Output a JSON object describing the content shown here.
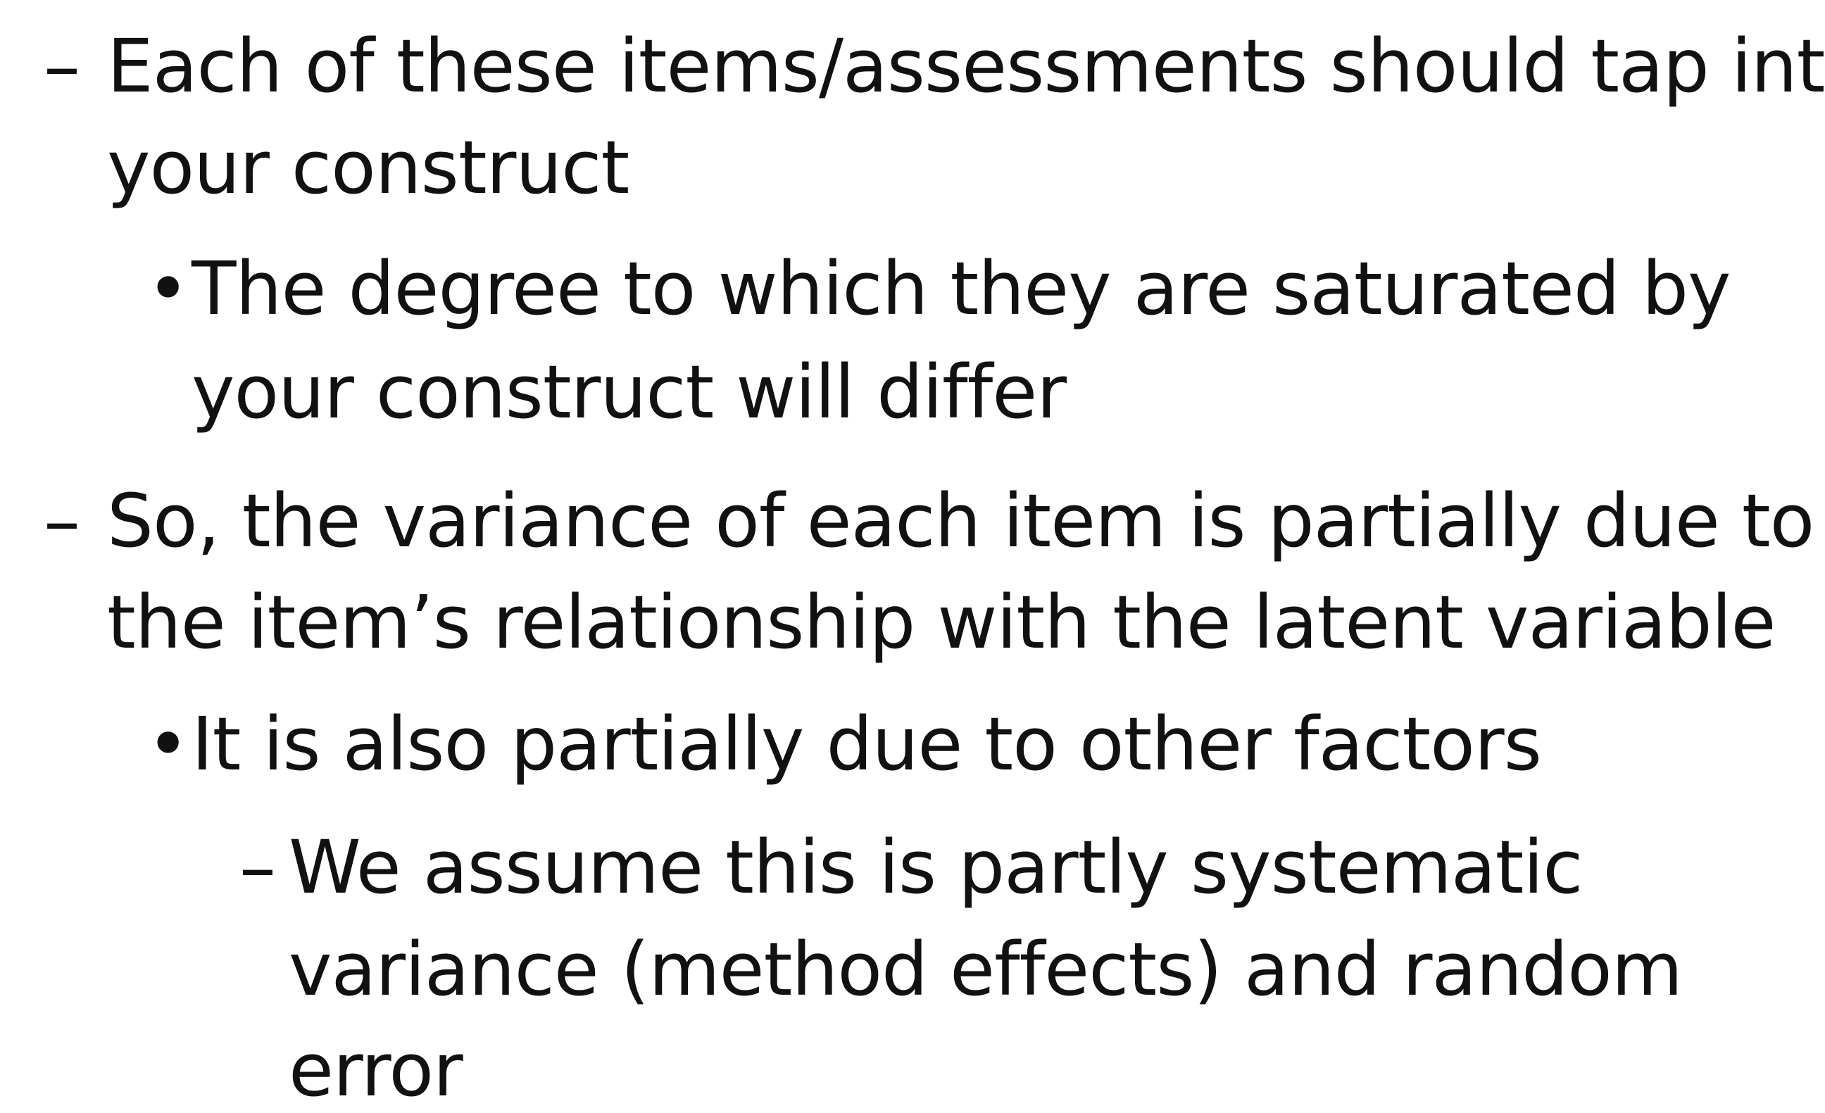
{
  "markers": {
    "dash": "–",
    "dot": "•"
  },
  "items": [
    {
      "level": 1,
      "lines": [
        "Each of these items/assessments should tap into",
        "your construct"
      ]
    },
    {
      "level": 2,
      "lines": [
        "The degree to which they are saturated by",
        "your construct will differ"
      ]
    },
    {
      "level": 1,
      "lines": [
        "So, the variance of each item is partially due to",
        "the item’s relationship with the latent variable"
      ]
    },
    {
      "level": 2,
      "lines": [
        "It is also partially due to other factors"
      ]
    },
    {
      "level": 3,
      "lines": [
        "We assume this is partly systematic",
        "variance (method effects) and random",
        "error"
      ]
    }
  ]
}
